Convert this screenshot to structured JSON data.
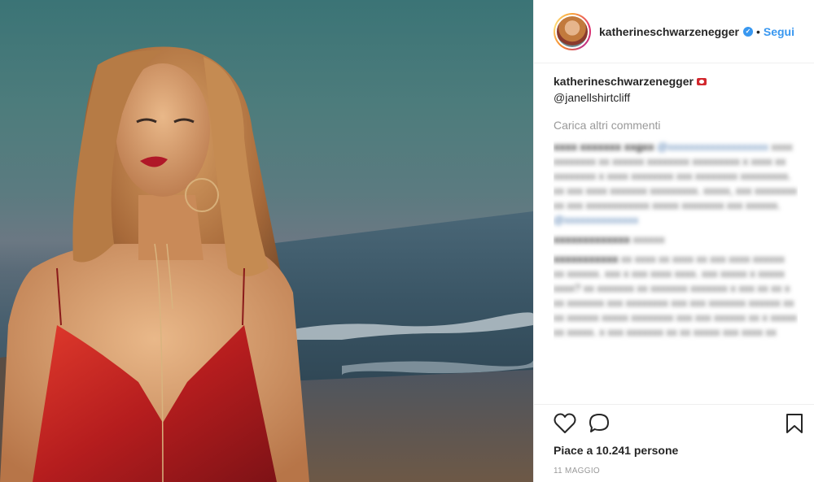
{
  "header": {
    "username": "katherineschwarzenegger",
    "separator": "•",
    "follow_label": "Segui"
  },
  "caption": {
    "username": "katherineschwarzenegger",
    "text": "@janellshirtcliff"
  },
  "comments": {
    "load_more": "Carica altri commenti"
  },
  "actions": {
    "likes": "Piace a 10.241 persone",
    "date": "11 MAGGIO"
  },
  "colors": {
    "accent": "#3897f0",
    "text": "#262626",
    "muted": "#999999"
  },
  "icons": [
    "heart-icon",
    "comment-icon",
    "bookmark-icon",
    "verified-icon",
    "camera-icon"
  ]
}
